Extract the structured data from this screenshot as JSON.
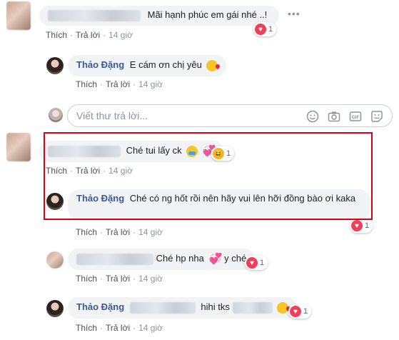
{
  "comments": {
    "c1": {
      "text": "Mãi hạnh phúc em gái nhé ..!",
      "reaction_count": "1",
      "like": "Thích",
      "reply": "Trả lời",
      "time": "14 giờ"
    },
    "r1": {
      "name": "Thảo Đặng",
      "text": "E cám ơn chị yêu",
      "like": "Thích",
      "reply": "Trả lời",
      "time": "14 giờ"
    },
    "reply_box": {
      "placeholder": "Viết thư trả lời..."
    },
    "c2": {
      "text": "Ché tui lấy ck",
      "reaction_count": "1",
      "like": "Thích",
      "reply": "Trả lời",
      "time": "14 giờ"
    },
    "r2": {
      "name": "Thảo Đặng",
      "text": "Ché có ng hốt rồi nên hãy vui lên hỡi đồng bào ơi kaka",
      "reaction_count": "1",
      "like": "Thích",
      "reply": "Trả lời",
      "time": "14 giờ"
    },
    "c3": {
      "text_a": "Ché hp nha",
      "text_b": "y ché",
      "reaction_count": "1",
      "like": "Thích",
      "reply": "Trả lời",
      "time": "14 giờ"
    },
    "r3": {
      "name": "Thảo Đặng",
      "text": "hihi tks",
      "reaction_count": "1",
      "like": "Thích",
      "reply": "Trả lời",
      "time": "14 giờ"
    }
  },
  "icons": [
    "more-icon",
    "heart-reaction-icon",
    "haha-reaction-icon",
    "emoji-icon",
    "camera-icon",
    "gif-icon",
    "sticker-icon"
  ],
  "colors": {
    "name": "#385898",
    "highlight": "#d0021b",
    "heart": "#f33e58"
  }
}
